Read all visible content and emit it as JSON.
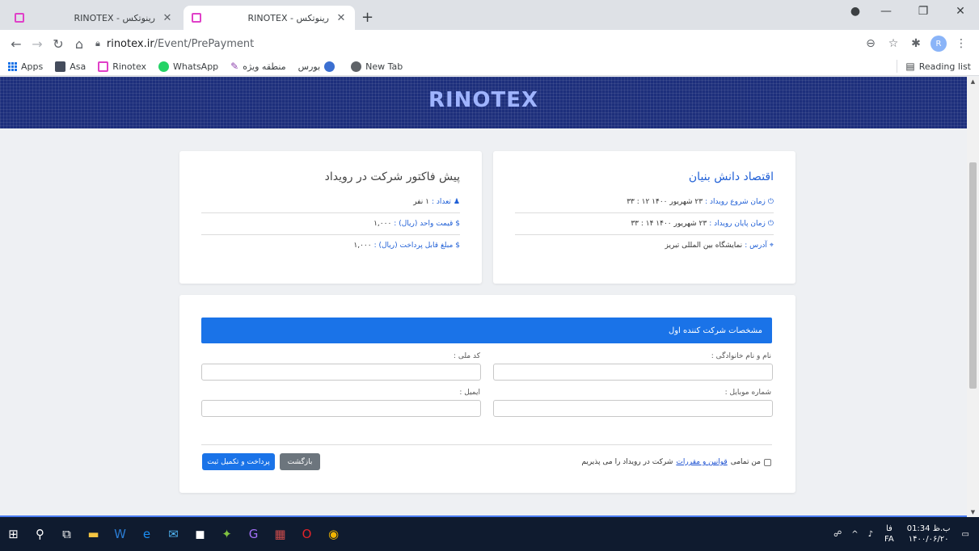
{
  "browser": {
    "tabs": [
      {
        "title": "RINOTEX - رینوتکس",
        "close": "✕"
      },
      {
        "title": "RINOTEX - رینوتکس",
        "close": "✕"
      }
    ],
    "new_tab": "+",
    "window_controls": {
      "minimize": "—",
      "maximize": "❐",
      "close": "✕"
    },
    "url_host": "rinotex.ir",
    "url_path": "/Event/PrePayment",
    "profile_initial": "R",
    "bookmarks": [
      {
        "label": "Apps",
        "icon": "apps-icon",
        "color": "#1a73e8"
      },
      {
        "label": "Asa",
        "icon": "asa-icon",
        "color": "#444c5c"
      },
      {
        "label": "Rinotex",
        "icon": "rinotex-icon",
        "color": "#e040c8"
      },
      {
        "label": "WhatsApp",
        "icon": "whatsapp-icon",
        "color": "#25d366"
      },
      {
        "label": "منطقه ویژه",
        "icon": "pencil-icon",
        "color": "#8e44ad"
      },
      {
        "label": "بورس",
        "icon": "bourse-icon",
        "color": "#3b6fd1"
      },
      {
        "label": "New Tab",
        "icon": "globe-icon",
        "color": "#5f6368"
      }
    ],
    "reading_list": "Reading list"
  },
  "site": {
    "brand": "RINOTEX",
    "event": {
      "title": "اقتصاد دانش بنیان",
      "start_label": "زمان شروع رویداد :",
      "start_value": "۲۳ شهریور ۱۴۰۰ ۱۲ : ۳۳",
      "end_label": "زمان پایان رویداد :",
      "end_value": "۲۳ شهریور ۱۴۰۰ ۱۴ : ۳۳",
      "address_label": "آدرس :",
      "address_value": "نمایشگاه بین المللی تبریز"
    },
    "invoice": {
      "title": "پیش فاکتور شرکت در رویداد",
      "count_label": "تعداد :",
      "count_value": "۱ نفر",
      "unit_price_label": "قیمت واحد (ریال) :",
      "unit_price_value": "۱,۰۰۰",
      "payable_label": "مبلغ قابل پرداخت (ریال) :",
      "payable_value": "۱,۰۰۰"
    },
    "form": {
      "header": "مشخصات شرکت کننده اول",
      "full_name_label": "نام و نام خانوادگی :",
      "national_code_label": "کد ملی :",
      "mobile_label": "شماره موبایل :",
      "email_label": "ایمیل :",
      "agree_prefix": "من تمامی",
      "agree_link": "قوانین و مقررات",
      "agree_suffix": "شرکت در رویداد را می پذیریم",
      "back_button": "بازگشت",
      "pay_button": "پرداخت و تکمیل ثبت"
    }
  },
  "taskbar": {
    "lang_short": "فا",
    "lang": "FA",
    "time": "01:34 ب.ظ",
    "date": "۱۴۰۰/۰۶/۲۰"
  }
}
